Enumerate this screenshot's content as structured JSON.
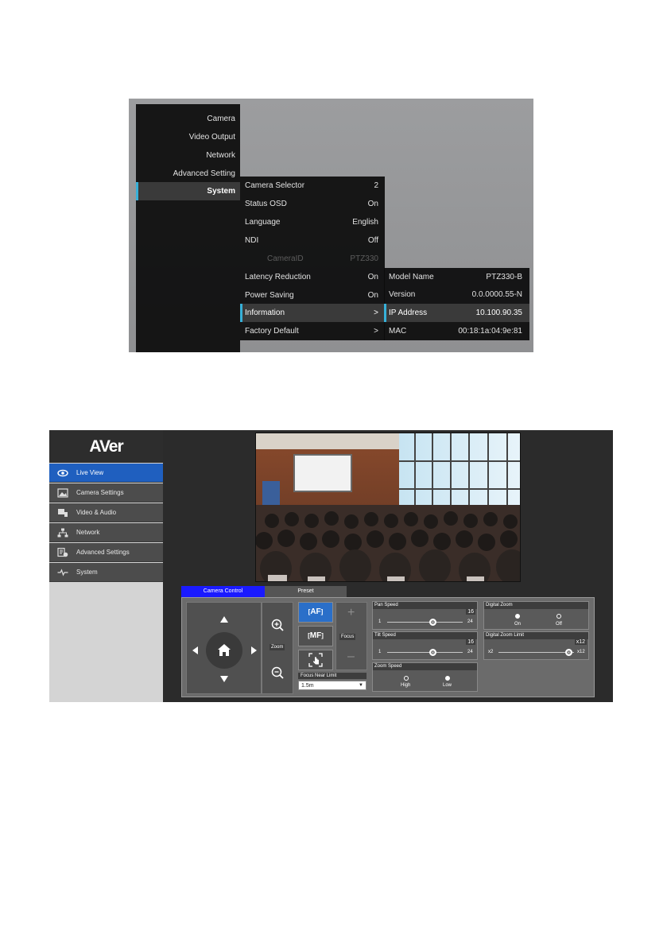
{
  "osd": {
    "main_menu": [
      "Camera",
      "Video Output",
      "Network",
      "Advanced Setting",
      "System"
    ],
    "system_menu": [
      {
        "label": "Camera Selector",
        "value": "2"
      },
      {
        "label": "Status OSD",
        "value": "On"
      },
      {
        "label": "Language",
        "value": "English"
      },
      {
        "label": "NDI",
        "value": "Off"
      },
      {
        "label": "CameraID",
        "value": "PTZ330"
      },
      {
        "label": "Latency Reduction",
        "value": "On"
      },
      {
        "label": "Power Saving",
        "value": "On"
      },
      {
        "label": "Information",
        "value": ">"
      },
      {
        "label": "Factory Default",
        "value": ">"
      }
    ],
    "information": [
      {
        "label": "Model Name",
        "value": "PTZ330-B"
      },
      {
        "label": "Version",
        "value": "0.0.0000.55-N"
      },
      {
        "label": "IP Address",
        "value": "10.100.90.35"
      },
      {
        "label": "MAC",
        "value": "00:18:1a:04:9e:81"
      }
    ],
    "colors": {
      "accent": "#37b0d8"
    }
  },
  "web": {
    "logo": "AVer",
    "nav": [
      {
        "label": "Live View",
        "icon": "eye-icon"
      },
      {
        "label": "Camera Settings",
        "icon": "image-icon"
      },
      {
        "label": "Video & Audio",
        "icon": "video-audio-icon"
      },
      {
        "label": "Network",
        "icon": "network-icon"
      },
      {
        "label": "Advanced Settings",
        "icon": "advanced-settings-icon"
      },
      {
        "label": "System",
        "icon": "pulse-icon"
      }
    ],
    "tabs": {
      "camera_control": "Camera Control",
      "preset": "Preset"
    },
    "zoom_label": "Zoom",
    "focus": {
      "af": "AF",
      "mf": "MF",
      "label": "Focus",
      "near_limit_label": "Focus Near Limit",
      "near_limit_value": "1.5m"
    },
    "pan_speed": {
      "label": "Pan Speed",
      "value": "16",
      "min": "1",
      "max": "24",
      "level": 16
    },
    "tilt_speed": {
      "label": "Tilt Speed",
      "value": "16",
      "min": "1",
      "max": "24",
      "level": 16
    },
    "zoom_speed": {
      "label": "Zoom Speed",
      "high": "High",
      "low": "Low",
      "selected": "Low"
    },
    "digital_zoom": {
      "label": "Digital Zoom",
      "on": "On",
      "off": "Off",
      "selected": "Off"
    },
    "digital_zoom_limit": {
      "label": "Digital Zoom Limit",
      "value": "x12",
      "min": "x2",
      "max": "x12",
      "level": 12
    },
    "colors": {
      "active_nav": "#1f5fbf",
      "active_tab": "#1a1aff",
      "focus_active": "#2a6fc9"
    }
  }
}
